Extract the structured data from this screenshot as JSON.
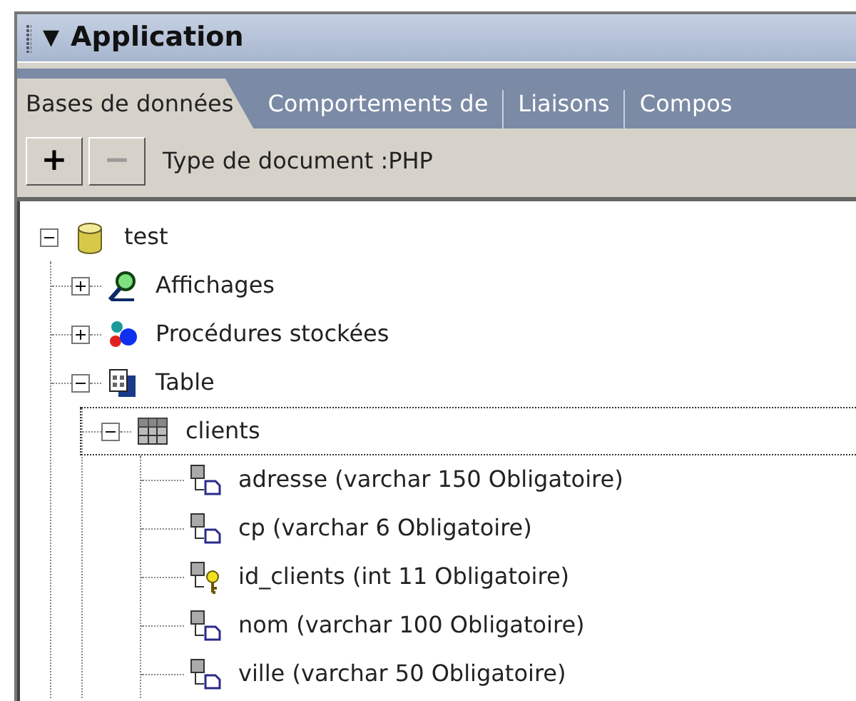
{
  "panel": {
    "toggle": "▼",
    "title": "Application"
  },
  "tabs": [
    {
      "label": "Bases de données",
      "selected": true
    },
    {
      "label": "Comportements de",
      "selected": false
    },
    {
      "label": "Liaisons",
      "selected": false
    },
    {
      "label": "Compos",
      "selected": false
    }
  ],
  "toolbar": {
    "buttons": [
      {
        "label": "+",
        "disabled": false
      },
      {
        "label": "−",
        "disabled": true
      }
    ],
    "document_type": "Type de document :PHP"
  },
  "tree": [
    {
      "label": "test",
      "kind": "database",
      "expanded": true,
      "selected": false,
      "children": [
        {
          "label": "Affichages",
          "kind": "views",
          "expanded": false,
          "selected": false
        },
        {
          "label": "Procédures stockées",
          "kind": "procedures",
          "expanded": false,
          "selected": false
        },
        {
          "label": "Table",
          "kind": "tables",
          "expanded": true,
          "selected": false,
          "children": [
            {
              "label": "clients",
              "kind": "table",
              "expanded": true,
              "selected": true,
              "children": [
                {
                  "label": "adresse (varchar 150 Obligatoire)",
                  "kind": "column",
                  "selected": false
                },
                {
                  "label": "cp (varchar 6 Obligatoire)",
                  "kind": "column",
                  "selected": false
                },
                {
                  "label": "id_clients (int 11 Obligatoire)",
                  "kind": "key",
                  "selected": false
                },
                {
                  "label": "nom (varchar 100 Obligatoire)",
                  "kind": "column",
                  "selected": false
                },
                {
                  "label": "ville (varchar 50 Obligatoire)",
                  "kind": "column",
                  "selected": false
                }
              ]
            }
          ]
        }
      ]
    }
  ]
}
